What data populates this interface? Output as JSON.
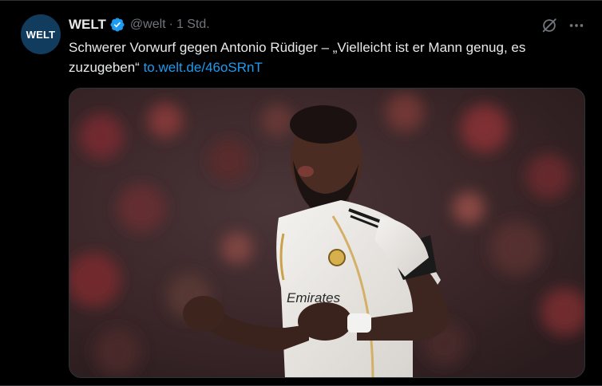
{
  "tweet": {
    "avatar_text": "WELT",
    "author_name": "WELT",
    "handle": "@welt",
    "separator": "·",
    "time": "1 Std.",
    "text": "Schwerer Vorwurf gegen Antonio Rüdiger – „Vielleicht ist er Mann genug, es zuzugeben“",
    "link": "to.welt.de/46oSRnT",
    "media": {
      "jersey_sponsor": "Emirates"
    }
  },
  "icons": {
    "verified": "verified-badge-icon",
    "grok": "grok-icon",
    "more": "more-options-icon"
  },
  "colors": {
    "background": "#000000",
    "text": "#e7e9ea",
    "secondary_text": "#71767b",
    "link": "#1d9bf0",
    "verified": "#1d9bf0",
    "avatar_bg": "#123c5e"
  }
}
